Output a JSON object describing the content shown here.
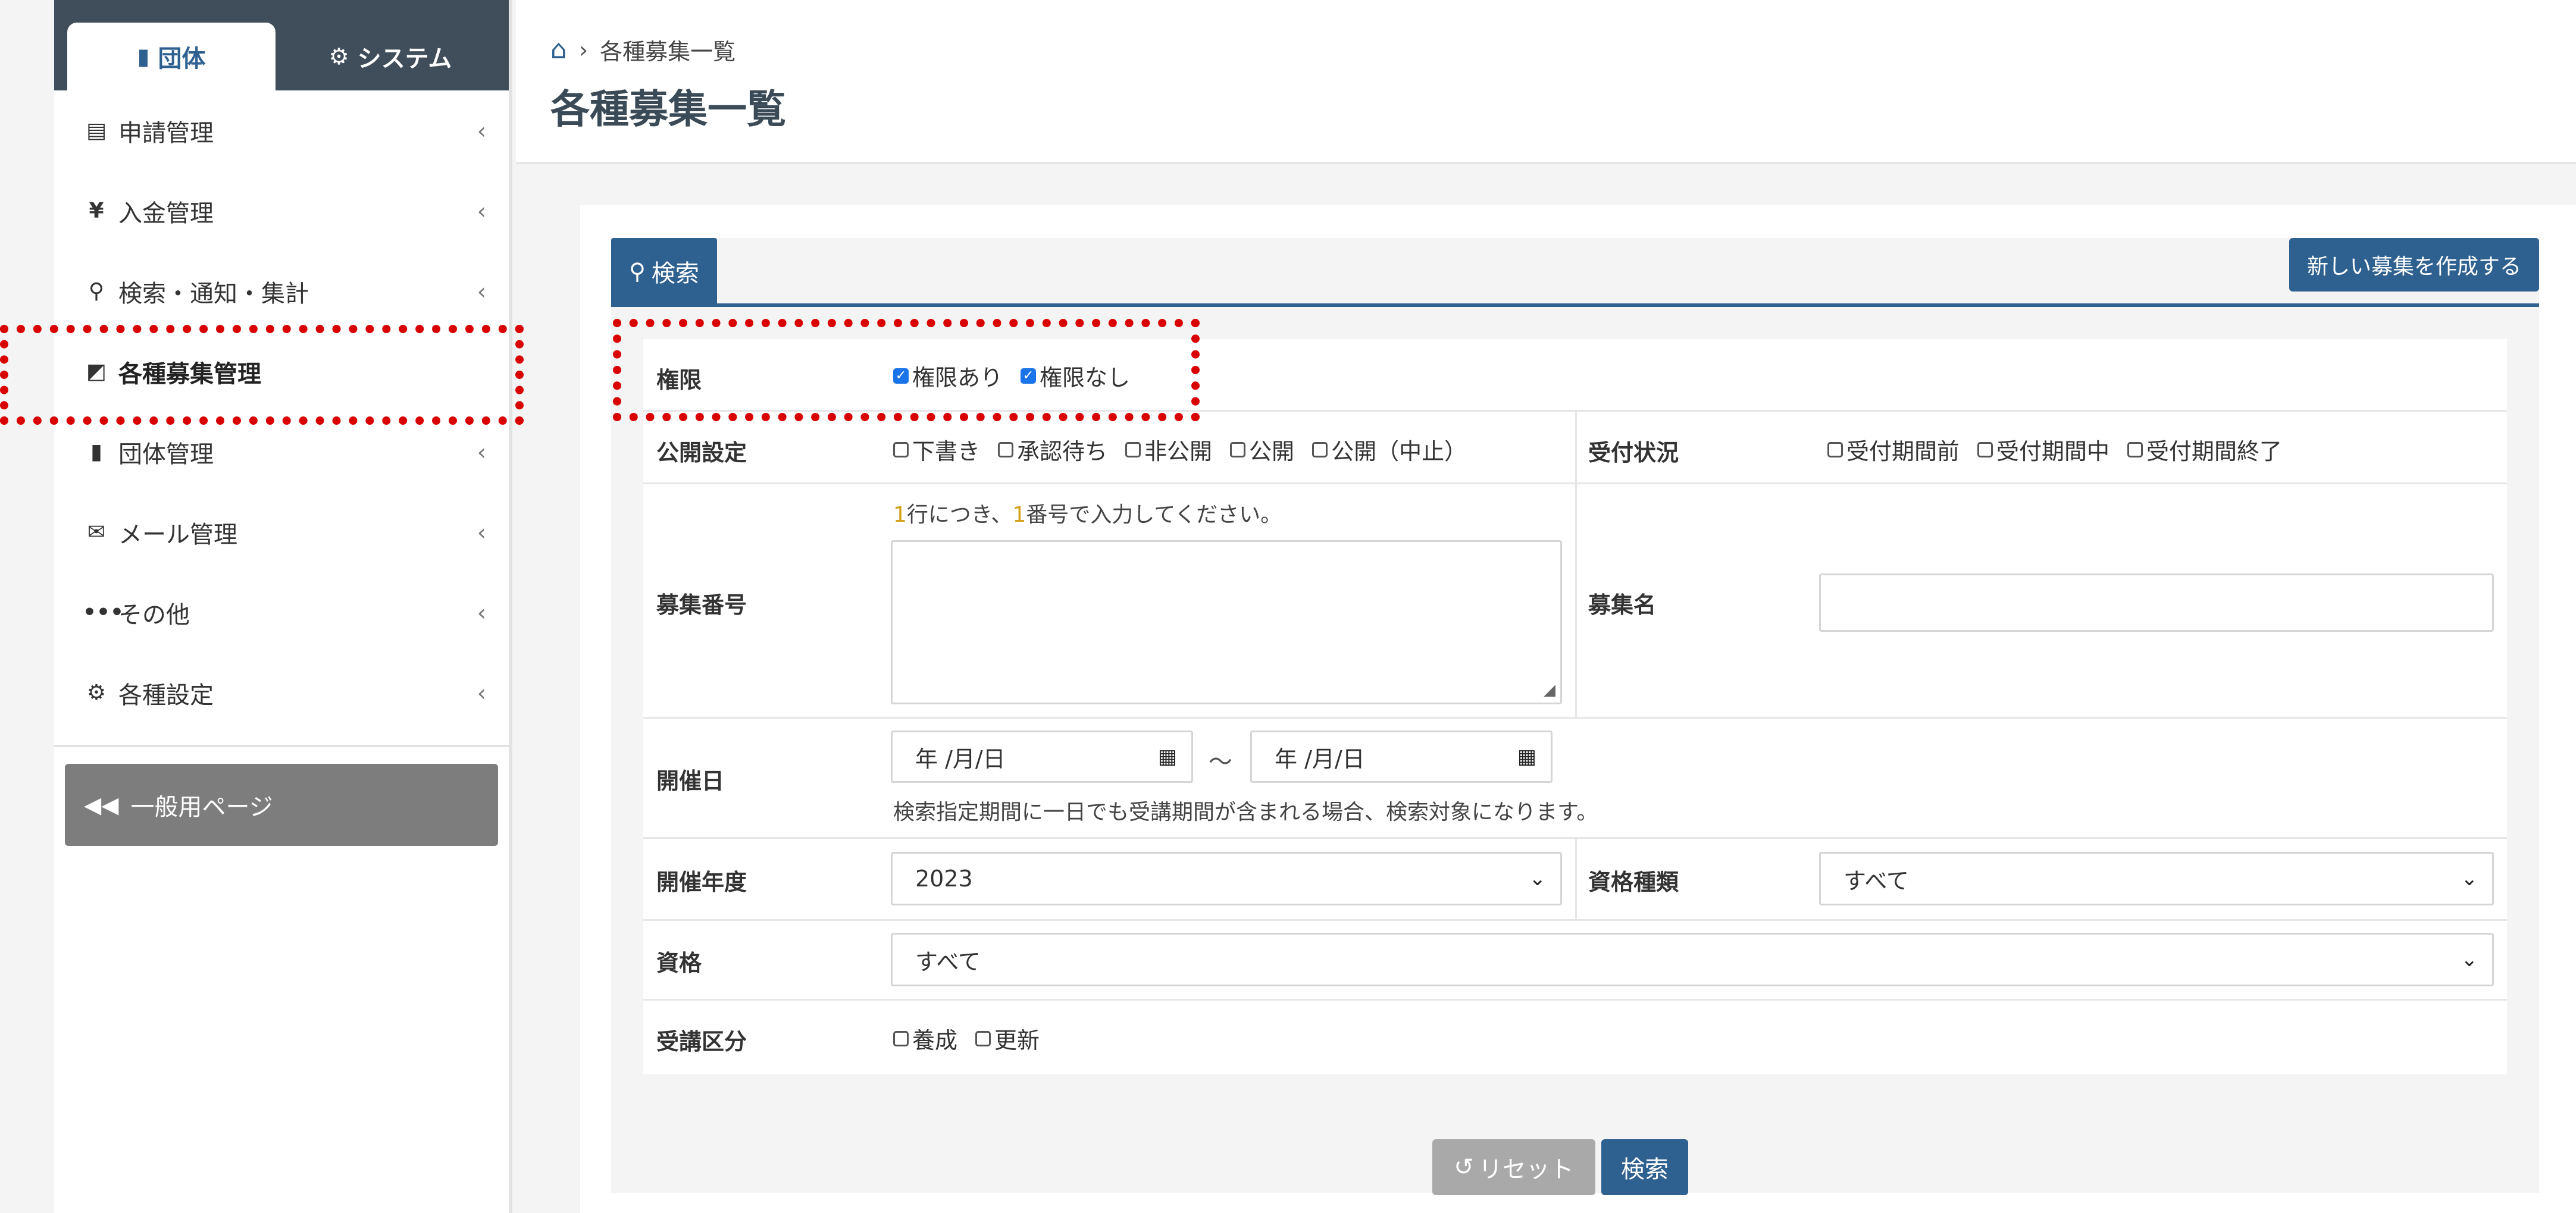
{
  "sidebar": {
    "tabs": [
      {
        "label": "団体",
        "icon": "building-icon"
      },
      {
        "label": "システム",
        "icon": "gear-icon"
      }
    ],
    "items": [
      {
        "label": "申請管理",
        "icon": "file-icon"
      },
      {
        "label": "入金管理",
        "icon": "yen-icon"
      },
      {
        "label": "検索・通知・集計",
        "icon": "search-icon"
      },
      {
        "label": "各種募集管理",
        "icon": "recruitment-icon"
      },
      {
        "label": "団体管理",
        "icon": "building-icon"
      },
      {
        "label": "メール管理",
        "icon": "envelope-icon"
      },
      {
        "label": "その他",
        "icon": "ellipsis-icon"
      },
      {
        "label": "各種設定",
        "icon": "gear-icon"
      }
    ],
    "general_page": "一般用ページ"
  },
  "header": {
    "breadcrumb": "各種募集一覧",
    "title": "各種募集一覧"
  },
  "panel": {
    "search_tab": "検索",
    "new_button": "新しい募集を作成する"
  },
  "form": {
    "permission": {
      "label": "権限",
      "options": [
        "権限あり",
        "権限なし"
      ]
    },
    "publish": {
      "label": "公開設定",
      "options": [
        "下書き",
        "承認待ち",
        "非公開",
        "公開",
        "公開（中止）"
      ]
    },
    "reception": {
      "label": "受付状況",
      "options": [
        "受付期間前",
        "受付期間中",
        "受付期間終了"
      ]
    },
    "recruit_no": {
      "label": "募集番号",
      "hint_a": "1",
      "hint_b": "行につき、",
      "hint_c": "1",
      "hint_d": "番号で入力してください。"
    },
    "recruit_name": {
      "label": "募集名",
      "value": ""
    },
    "date": {
      "label": "開催日",
      "from_placeholder": "年 /月/日",
      "to_placeholder": "年 /月/日",
      "tilde": "～",
      "note": "検索指定期間に一日でも受講期間が含まれる場合、検索対象になります。"
    },
    "year": {
      "label": "開催年度",
      "value": "2023"
    },
    "qual_type": {
      "label": "資格種類",
      "value": "すべて"
    },
    "qual": {
      "label": "資格",
      "value": "すべて"
    },
    "course": {
      "label": "受講区分",
      "options": [
        "養成",
        "更新"
      ]
    },
    "reset_button": "リセット",
    "search_button": "検索"
  },
  "colors": {
    "primary": "#2e6090",
    "sidebar_header": "#3f4e5a",
    "highlight": "#d90000"
  }
}
